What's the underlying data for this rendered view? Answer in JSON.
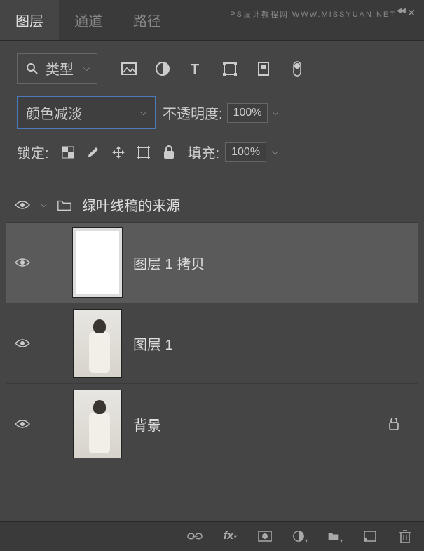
{
  "watermark": "PS设计教程网 WWW.MISSYUAN.NET",
  "tabs": {
    "layers": "图层",
    "channels": "通道",
    "paths": "路径"
  },
  "filter": {
    "label": "类型"
  },
  "blend": {
    "mode": "颜色减淡",
    "opacity_label": "不透明度:",
    "opacity_value": "100%"
  },
  "lock": {
    "label": "锁定:",
    "fill_label": "填充:",
    "fill_value": "100%"
  },
  "group": {
    "name": "绿叶线稿的来源"
  },
  "layers_list": [
    {
      "name": "图层 1 拷贝",
      "selected": true,
      "thumb": "white"
    },
    {
      "name": "图层 1",
      "selected": false,
      "thumb": "photo"
    },
    {
      "name": "背景",
      "selected": false,
      "thumb": "photo",
      "locked": true
    }
  ]
}
